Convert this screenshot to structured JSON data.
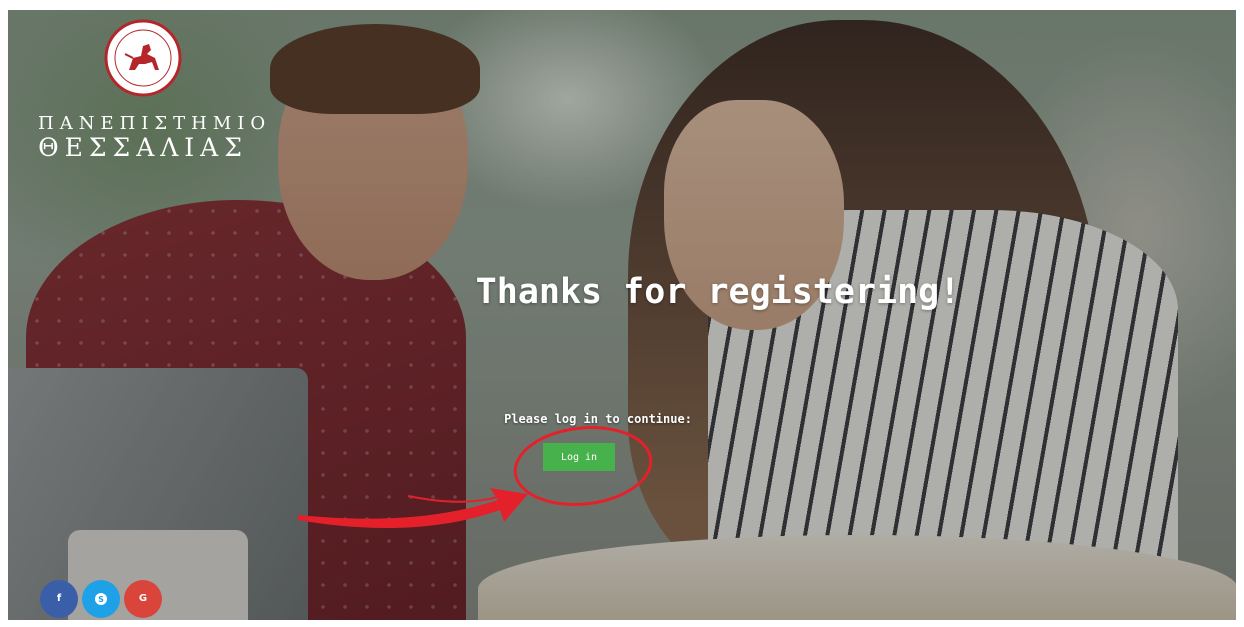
{
  "logo": {
    "line1": "ΠΑΝΕΠΙΣΤΗΜΙΟ",
    "line2": "ΘΕΣΣΑΛΙΑΣ",
    "seal_color": "#b5262b"
  },
  "main": {
    "headline": "Thanks for registering!",
    "prompt": "Please log in to continue:",
    "login_label": "Log in"
  },
  "social": [
    {
      "glyph": "f",
      "icon": "facebook-icon",
      "color": "#3b5ea8"
    },
    {
      "glyph": "S",
      "icon": "skype-icon",
      "color": "#1ea1e6"
    },
    {
      "glyph": "G",
      "icon": "google-icon",
      "color": "#d9453b"
    }
  ],
  "colors": {
    "accent_button": "#47b24b",
    "annotation": "#e4212b"
  }
}
